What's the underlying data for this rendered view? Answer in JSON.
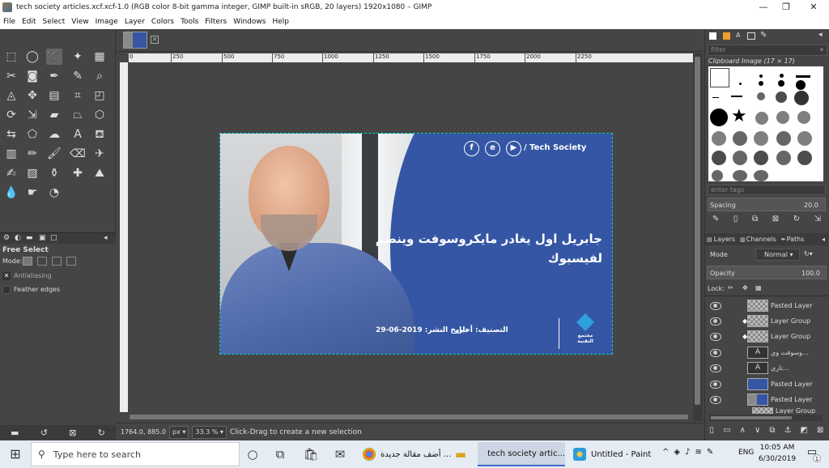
{
  "window": {
    "title": "tech society articles.xcf.xcf-1.0 (RGB color 8-bit gamma integer, GIMP built-in sRGB, 20 layers) 1920x1080 – GIMP",
    "min": "—",
    "max": "❐",
    "close": "✕"
  },
  "menu": [
    "File",
    "Edit",
    "Select",
    "View",
    "Image",
    "Layer",
    "Colors",
    "Tools",
    "Filters",
    "Windows",
    "Help"
  ],
  "ruler_ticks": [
    "0",
    "250",
    "500",
    "750",
    "1000",
    "1250",
    "1500",
    "1750",
    "2000",
    "2250"
  ],
  "tool_options": {
    "title": "Free Select",
    "mode_label": "Mode:",
    "antialiasing": "Antialiasing",
    "feather": "Feather edges"
  },
  "status": {
    "coords": "1764.0, 885.0",
    "unit": "px",
    "zoom": "33.3 %",
    "message": "Click-Drag to create a new selection"
  },
  "image": {
    "brand": "/ Tech Society",
    "social": [
      "f",
      "e",
      "▶"
    ],
    "headline": "جابريل اول يغادر مايكروسوفت وينضم لفيسبوك",
    "category": "التصنيف: أخبار",
    "date": "تاريخ النشر: 2019-06-29",
    "logo_text": "مجتمع التقنية"
  },
  "brushes": {
    "filter_placeholder": "filter",
    "current": "Clipboard Image (17 × 17)",
    "tags_placeholder": "enter tags",
    "spacing_label": "Spacing",
    "spacing_value": "20.0"
  },
  "dock_tabs": [
    "Layers",
    "Channels",
    "Paths"
  ],
  "layers_panel": {
    "mode_label": "Mode",
    "mode_value": "Normal",
    "opacity_label": "Opacity",
    "opacity_value": "100.0",
    "lock_label": "Lock:"
  },
  "layers": [
    "Pasted Layer",
    "Layer Group",
    "Layer Group #",
    "وسوفت وي...",
    "تاري...",
    "Pasted Layer",
    "Pasted Layer",
    "Layer Group"
  ],
  "taskbar": {
    "search_placeholder": "Type here to search",
    "apps": [
      "أضف مقالة جديدة ...",
      "tech society artic...",
      "Untitled - Paint"
    ],
    "lang": "ENG",
    "time": "10:05 AM",
    "date": "6/30/2019",
    "notif_count": "1"
  }
}
